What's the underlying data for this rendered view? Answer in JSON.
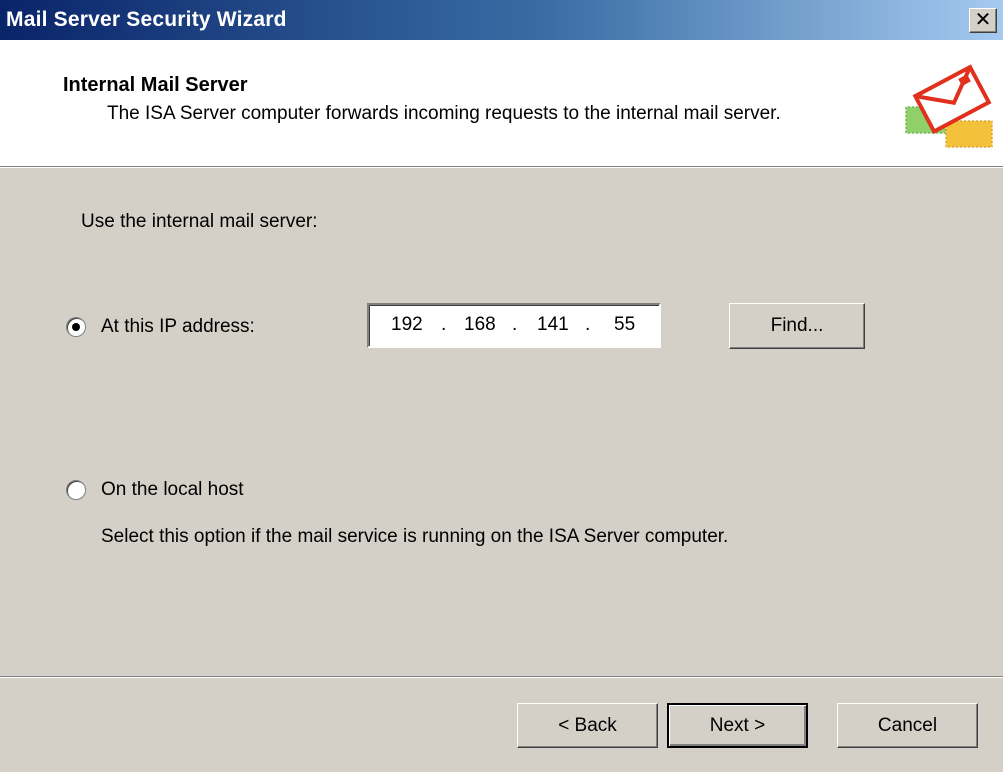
{
  "window": {
    "title": "Mail Server Security Wizard",
    "close_icon": "close-icon"
  },
  "header": {
    "title": "Internal Mail Server",
    "subtitle": "The ISA Server computer forwards incoming requests to the internal mail server.",
    "icon": "mail-envelope-icon"
  },
  "body": {
    "intro": "Use the internal mail server:",
    "option_ip": {
      "label": "At this IP address:",
      "selected": true,
      "ip": [
        "192",
        "168",
        "141",
        "55"
      ],
      "separator": ".",
      "find_label": "Find..."
    },
    "option_local": {
      "label": "On the local host",
      "selected": false,
      "description": "Select this option if the mail service is running on the ISA Server computer."
    }
  },
  "footer": {
    "back_label": "< Back",
    "next_label": "Next >",
    "cancel_label": "Cancel"
  }
}
